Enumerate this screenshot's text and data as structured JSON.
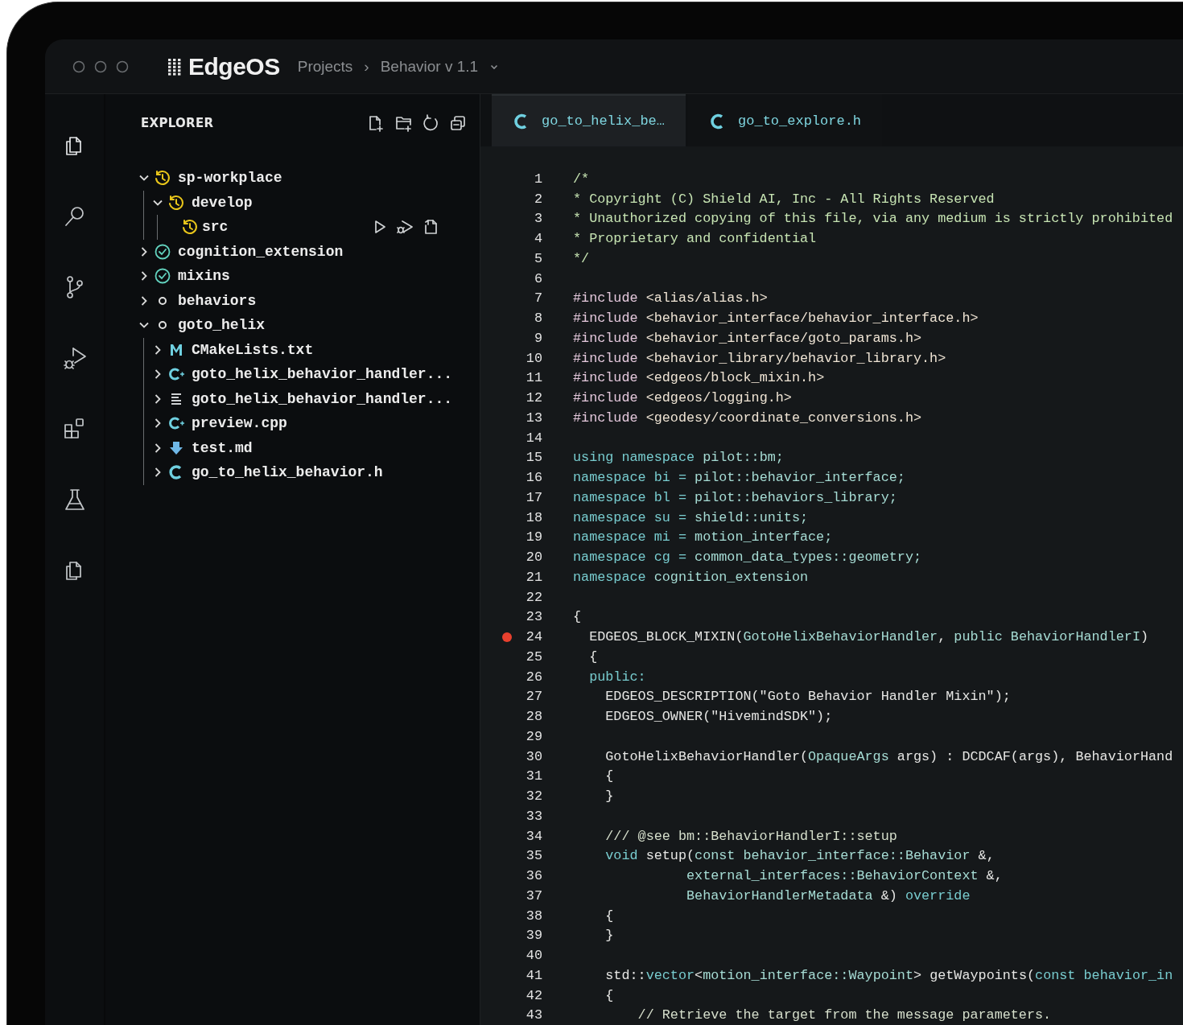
{
  "titlebar": {
    "logo": "EdgeOS",
    "breadcrumb": [
      {
        "label": "Projects"
      },
      {
        "label": "Behavior v 1.1"
      }
    ],
    "separator": "›"
  },
  "activity_bar": [
    {
      "kind": "files",
      "selected": true
    },
    {
      "kind": "search",
      "selected": false
    },
    {
      "kind": "branch",
      "selected": false
    },
    {
      "kind": "debug",
      "selected": false
    },
    {
      "kind": "extensions",
      "selected": false
    },
    {
      "kind": "flask",
      "selected": false
    },
    {
      "kind": "files",
      "selected": false
    }
  ],
  "explorer": {
    "title": "EXPLORER",
    "tree": [
      {
        "name": "sp-workplace",
        "kind": "history",
        "expandable": true,
        "expanded": true,
        "show_actions": false,
        "children": [
          {
            "name": "develop",
            "kind": "history",
            "expandable": true,
            "expanded": true,
            "show_actions": false,
            "children": [
              {
                "name": "src",
                "kind": "history",
                "expandable": false,
                "show_actions": true
              }
            ]
          }
        ]
      },
      {
        "name": "cognition_extension",
        "kind": "check",
        "expandable": true,
        "expanded": false,
        "show_actions": false
      },
      {
        "name": "mixins",
        "kind": "check",
        "expandable": true,
        "expanded": false,
        "show_actions": false
      },
      {
        "name": "behaviors",
        "kind": "circle",
        "expandable": true,
        "expanded": false,
        "show_actions": false
      },
      {
        "name": "goto_helix",
        "kind": "circle",
        "expandable": true,
        "expanded": true,
        "show_actions": false,
        "children": [
          {
            "name": "CMakeLists.txt",
            "kind": "cmake",
            "expandable": true,
            "expanded": false,
            "show_actions": false
          },
          {
            "name": "goto_helix_behavior_handler...",
            "kind": "cpp",
            "expandable": true,
            "expanded": false,
            "show_actions": false
          },
          {
            "name": "goto_helix_behavior_handler...",
            "kind": "list",
            "expandable": true,
            "expanded": false,
            "show_actions": false
          },
          {
            "name": "preview.cpp",
            "kind": "cpp",
            "expandable": true,
            "expanded": false,
            "show_actions": false
          },
          {
            "name": "test.md",
            "kind": "md",
            "expandable": true,
            "expanded": false,
            "show_actions": false
          },
          {
            "name": "go_to_helix_behavior.h",
            "kind": "c",
            "expandable": true,
            "expanded": false,
            "show_actions": false
          }
        ]
      }
    ]
  },
  "tabs": [
    {
      "label": "go_to_helix_be…",
      "selected": true
    },
    {
      "label": "go_to_explore.h",
      "selected": false
    }
  ],
  "code": [
    {
      "n": "1",
      "breakpoint": false,
      "tokens": [
        {
          "t": "/*",
          "kind": "comment"
        }
      ]
    },
    {
      "n": "2",
      "breakpoint": false,
      "tokens": [
        {
          "t": "* Copyright (C) Shield AI, Inc - All Rights Reserved",
          "kind": "comment"
        }
      ]
    },
    {
      "n": "3",
      "breakpoint": false,
      "tokens": [
        {
          "t": "* Unauthorized copying of this file, via any medium is strictly prohibited",
          "kind": "comment"
        }
      ]
    },
    {
      "n": "4",
      "breakpoint": false,
      "tokens": [
        {
          "t": "* Proprietary and confidential",
          "kind": "comment"
        }
      ]
    },
    {
      "n": "5",
      "breakpoint": false,
      "tokens": [
        {
          "t": "*/",
          "kind": "comment"
        }
      ]
    },
    {
      "n": "6",
      "breakpoint": false
    },
    {
      "n": "7",
      "breakpoint": false,
      "tokens": [
        {
          "t": "#include",
          "kind": "pre"
        },
        {
          "t": " <alias/alias.h>",
          "kind": "path"
        }
      ]
    },
    {
      "n": "8",
      "breakpoint": false,
      "tokens": [
        {
          "t": "#include",
          "kind": "pre"
        },
        {
          "t": " <behavior_interface/behavior_interface.h>",
          "kind": "path"
        }
      ]
    },
    {
      "n": "9",
      "breakpoint": false,
      "tokens": [
        {
          "t": "#include",
          "kind": "pre"
        },
        {
          "t": " <behavior_interface/goto_params.h>",
          "kind": "path"
        }
      ]
    },
    {
      "n": "10",
      "breakpoint": false,
      "tokens": [
        {
          "t": "#include",
          "kind": "pre"
        },
        {
          "t": " <behavior_library/behavior_library.h>",
          "kind": "path"
        }
      ]
    },
    {
      "n": "11",
      "breakpoint": false,
      "tokens": [
        {
          "t": "#include",
          "kind": "pre"
        },
        {
          "t": " <edgeos/block_mixin.h>",
          "kind": "path"
        }
      ]
    },
    {
      "n": "12",
      "breakpoint": false,
      "tokens": [
        {
          "t": "#include",
          "kind": "pre"
        },
        {
          "t": " <edgeos/logging.h>",
          "kind": "path"
        }
      ]
    },
    {
      "n": "13",
      "breakpoint": false,
      "tokens": [
        {
          "t": "#include",
          "kind": "pre"
        },
        {
          "t": " <geodesy/coordinate_conversions.h>",
          "kind": "path"
        }
      ]
    },
    {
      "n": "14",
      "breakpoint": false
    },
    {
      "n": "15",
      "breakpoint": false,
      "tokens": [
        {
          "t": "using namespace",
          "kind": "kw"
        },
        {
          "t": " pilot::bm;",
          "kind": "ns"
        }
      ]
    },
    {
      "n": "16",
      "breakpoint": false,
      "tokens": [
        {
          "t": "namespace bi = ",
          "kind": "kw"
        },
        {
          "t": "pilot::behavior_interface;",
          "kind": "ns"
        }
      ]
    },
    {
      "n": "17",
      "breakpoint": false,
      "tokens": [
        {
          "t": "namespace bl = ",
          "kind": "kw"
        },
        {
          "t": "pilot::behaviors_library;",
          "kind": "ns"
        }
      ]
    },
    {
      "n": "18",
      "breakpoint": false,
      "tokens": [
        {
          "t": "namespace su = ",
          "kind": "kw"
        },
        {
          "t": "shield::units;",
          "kind": "ns"
        }
      ]
    },
    {
      "n": "19",
      "breakpoint": false,
      "tokens": [
        {
          "t": "namespace mi = ",
          "kind": "kw"
        },
        {
          "t": "motion_interface;",
          "kind": "ns"
        }
      ]
    },
    {
      "n": "20",
      "breakpoint": false,
      "tokens": [
        {
          "t": "namespace cg = ",
          "kind": "kw"
        },
        {
          "t": "common_data_types::geometry;",
          "kind": "ns"
        }
      ]
    },
    {
      "n": "21",
      "breakpoint": false,
      "tokens": [
        {
          "t": "namespace ",
          "kind": "kw"
        },
        {
          "t": "cognition_extension",
          "kind": "ns"
        }
      ]
    },
    {
      "n": "22",
      "breakpoint": false
    },
    {
      "n": "23",
      "breakpoint": false,
      "tokens": [
        {
          "t": "{",
          "kind": "plain"
        }
      ]
    },
    {
      "n": "24",
      "breakpoint": true,
      "tokens": [
        {
          "t": "  EDGEOS_BLOCK_MIXIN(",
          "kind": "plain"
        },
        {
          "t": "GotoHelixBehaviorHandler",
          "kind": "ns"
        },
        {
          "t": ", ",
          "kind": "plain"
        },
        {
          "t": "public BehaviorHandlerI",
          "kind": "ns"
        },
        {
          "t": ")",
          "kind": "plain"
        }
      ]
    },
    {
      "n": "25",
      "breakpoint": false,
      "tokens": [
        {
          "t": "  {",
          "kind": "plain"
        }
      ]
    },
    {
      "n": "26",
      "breakpoint": false,
      "tokens": [
        {
          "t": "  public:",
          "kind": "kw"
        }
      ]
    },
    {
      "n": "27",
      "breakpoint": false,
      "tokens": [
        {
          "t": "    EDGEOS_DESCRIPTION(\"Goto Behavior Handler Mixin\");",
          "kind": "plain"
        }
      ]
    },
    {
      "n": "28",
      "breakpoint": false,
      "tokens": [
        {
          "t": "    EDGEOS_OWNER(\"HivemindSDK\");",
          "kind": "plain"
        }
      ]
    },
    {
      "n": "29",
      "breakpoint": false
    },
    {
      "n": "30",
      "breakpoint": false,
      "tokens": [
        {
          "t": "    GotoHelixBehaviorHandler(",
          "kind": "plain"
        },
        {
          "t": "OpaqueArgs",
          "kind": "ns"
        },
        {
          "t": " args) : DCDCAF(args), BehaviorHand",
          "kind": "plain"
        }
      ]
    },
    {
      "n": "31",
      "breakpoint": false,
      "tokens": [
        {
          "t": "    {",
          "kind": "plain"
        }
      ]
    },
    {
      "n": "32",
      "breakpoint": false,
      "tokens": [
        {
          "t": "    }",
          "kind": "plain"
        }
      ]
    },
    {
      "n": "33",
      "breakpoint": false
    },
    {
      "n": "34",
      "breakpoint": false,
      "tokens": [
        {
          "t": "    /// @see bm::BehaviorHandlerI::setup",
          "kind": "doc"
        }
      ]
    },
    {
      "n": "35",
      "breakpoint": false,
      "tokens": [
        {
          "t": "    void",
          "kind": "kw"
        },
        {
          "t": " setup(",
          "kind": "plain"
        },
        {
          "t": "const behavior_interface::Behavior",
          "kind": "ns"
        },
        {
          "t": " &,",
          "kind": "plain"
        }
      ]
    },
    {
      "n": "36",
      "breakpoint": false,
      "tokens": [
        {
          "t": "              external_interfaces::BehaviorContext",
          "kind": "ns"
        },
        {
          "t": " &,",
          "kind": "plain"
        }
      ]
    },
    {
      "n": "37",
      "breakpoint": false,
      "tokens": [
        {
          "t": "              BehaviorHandlerMetadata",
          "kind": "ns"
        },
        {
          "t": " &) ",
          "kind": "plain"
        },
        {
          "t": "override",
          "kind": "kw"
        }
      ]
    },
    {
      "n": "38",
      "breakpoint": false,
      "tokens": [
        {
          "t": "    {",
          "kind": "plain"
        }
      ]
    },
    {
      "n": "39",
      "breakpoint": false,
      "tokens": [
        {
          "t": "    }",
          "kind": "plain"
        }
      ]
    },
    {
      "n": "40",
      "breakpoint": false
    },
    {
      "n": "41",
      "breakpoint": false,
      "tokens": [
        {
          "t": "    std::",
          "kind": "plain"
        },
        {
          "t": "vector",
          "kind": "kw"
        },
        {
          "t": "<",
          "kind": "plain"
        },
        {
          "t": "motion_interface::Waypoint",
          "kind": "ns"
        },
        {
          "t": "> getWaypoints(",
          "kind": "plain"
        },
        {
          "t": "const behavior_in",
          "kind": "kw"
        }
      ]
    },
    {
      "n": "42",
      "breakpoint": false,
      "tokens": [
        {
          "t": "    {",
          "kind": "plain"
        }
      ]
    },
    {
      "n": "43",
      "breakpoint": false,
      "tokens": [
        {
          "t": "        // Retrieve the target from the message parameters.",
          "kind": "doc"
        }
      ]
    }
  ]
}
